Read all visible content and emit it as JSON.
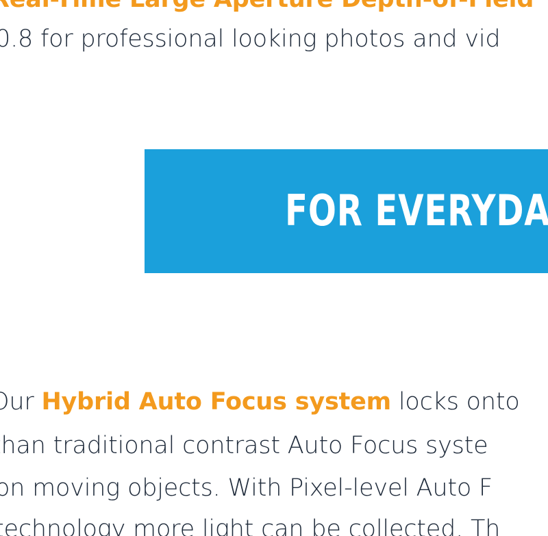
{
  "top": {
    "heading": "Real-Time Large Aperture Depth-of-Field",
    "subline": "0.8 for professional looking photos and vid"
  },
  "banner": {
    "text": "FOR EVERYDA",
    "color": "#1ba0db"
  },
  "paragraph": {
    "line1_prefix": "Our",
    "line1_highlight": "Hybrid Auto Focus system",
    "line1_suffix": "locks onto",
    "line2": "than traditional contrast Auto Focus syste",
    "line3": "on moving objects. With Pixel-level Auto F",
    "line4": "technology more light can be collected. Th"
  },
  "colors": {
    "accent": "#f39a1e",
    "text": "#1e2a3a",
    "banner": "#1ba0db"
  }
}
